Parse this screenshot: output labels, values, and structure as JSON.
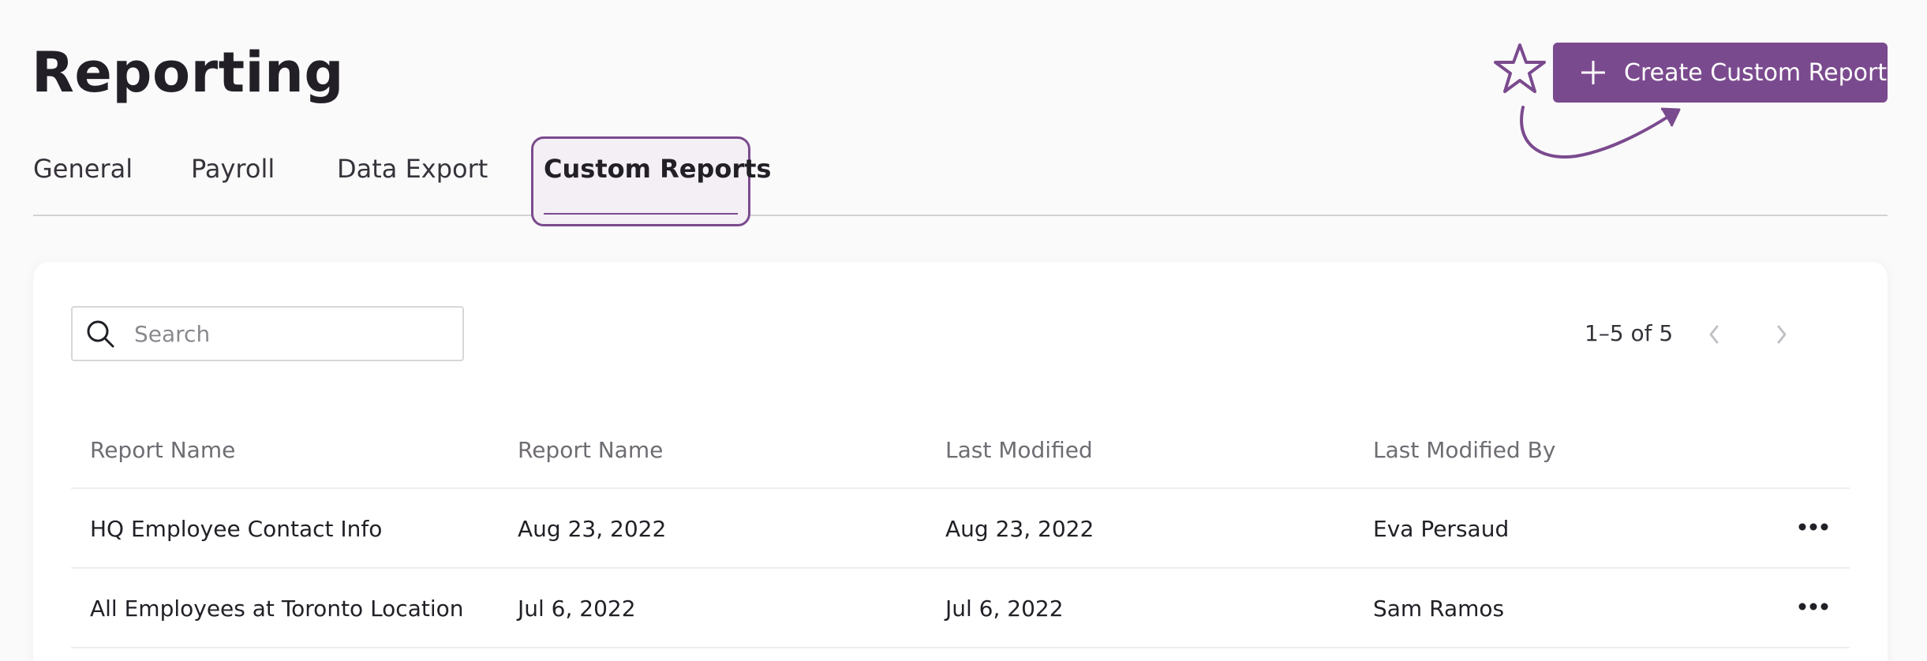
{
  "page": {
    "title": "Reporting"
  },
  "tabs": [
    {
      "label": "General",
      "active": false
    },
    {
      "label": "Payroll",
      "active": false
    },
    {
      "label": "Data Export",
      "active": false
    },
    {
      "label": "Custom Reports",
      "active": true
    }
  ],
  "actions": {
    "create_label": "Create Custom Report",
    "create_icon": "plus-icon",
    "annotation_icon": "star-icon"
  },
  "search": {
    "placeholder": "Search",
    "value": ""
  },
  "pagination": {
    "label": "1–5 of 5"
  },
  "table": {
    "columns": [
      "Report Name",
      "Report Name",
      "Last Modified",
      "Last Modified By"
    ],
    "rows": [
      [
        "HQ Employee Contact Info",
        "Aug 23, 2022",
        "Aug 23, 2022",
        "Eva Persaud"
      ],
      [
        "All Employees at Toronto Location",
        "Jul 6, 2022",
        "Jul 6, 2022",
        "Sam Ramos"
      ]
    ]
  },
  "colors": {
    "accent": "#7a4a8e",
    "background": "#fbfafb",
    "text": "#222026",
    "muted": "#6f6c72"
  }
}
